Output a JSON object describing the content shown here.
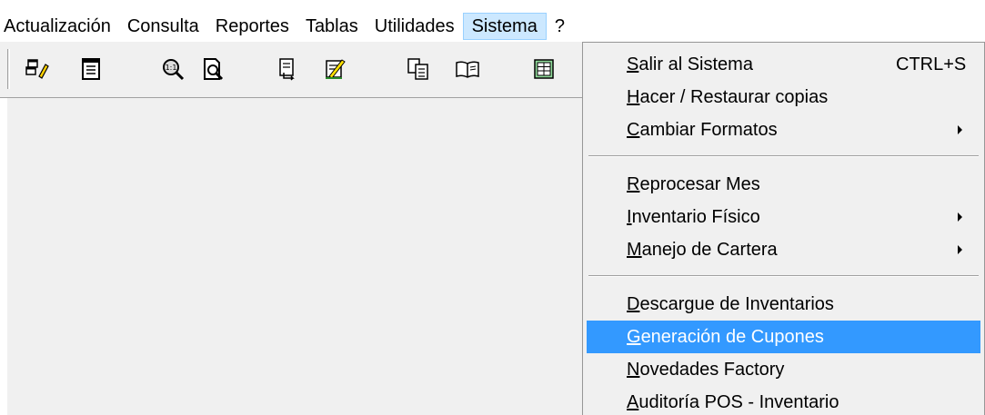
{
  "menubar": {
    "items": [
      {
        "label": "Actualización"
      },
      {
        "label": "Consulta"
      },
      {
        "label": "Reportes"
      },
      {
        "label": "Tablas"
      },
      {
        "label": "Utilidades"
      },
      {
        "label": "Sistema"
      },
      {
        "label": "?"
      }
    ],
    "active": "Sistema"
  },
  "toolbar": {
    "buttons": [
      {
        "icon": "window-edit-icon"
      },
      {
        "icon": "notepad-icon"
      },
      {
        "icon": "zoom-1-1-icon"
      },
      {
        "icon": "print-preview-icon"
      },
      {
        "icon": "document-arrow-icon"
      },
      {
        "icon": "document-edit-icon"
      },
      {
        "icon": "copy-pages-icon"
      },
      {
        "icon": "open-book-icon"
      },
      {
        "icon": "spreadsheet-icon"
      }
    ]
  },
  "sistema_menu": {
    "items": [
      {
        "label": "Salir al Sistema",
        "mnemonic": "S",
        "rest": "alir al Sistema",
        "shortcut": "CTRL+S"
      },
      {
        "label": "Hacer / Restaurar copias",
        "mnemonic": "H",
        "rest": "acer / Restaurar copias"
      },
      {
        "label": "Cambiar Formatos",
        "mnemonic": "C",
        "rest": "ambiar Formatos",
        "submenu": true
      },
      {
        "label": "Reprocesar Mes",
        "mnemonic": "R",
        "rest": "eprocesar Mes"
      },
      {
        "label": "Inventario Físico",
        "mnemonic": "I",
        "rest": "nventario Físico",
        "submenu": true
      },
      {
        "label": "Manejo de Cartera",
        "mnemonic": "M",
        "rest": "anejo de Cartera",
        "submenu": true
      },
      {
        "label": "Descargue de Inventarios",
        "mnemonic": "D",
        "rest": "escargue de Inventarios"
      },
      {
        "label": "Generación de Cupones",
        "mnemonic": "G",
        "rest": "eneración de Cupones",
        "selected": true
      },
      {
        "label": "Novedades Factory",
        "mnemonic": "N",
        "rest": "ovedades Factory"
      },
      {
        "label": "Auditoría POS - Inventario",
        "mnemonic": "A",
        "rest": "uditoría POS - Inventario"
      }
    ]
  },
  "colors": {
    "highlight": "#3399ff",
    "menu_active": "#cce8ff",
    "menu_bg": "#f0f0f0"
  }
}
